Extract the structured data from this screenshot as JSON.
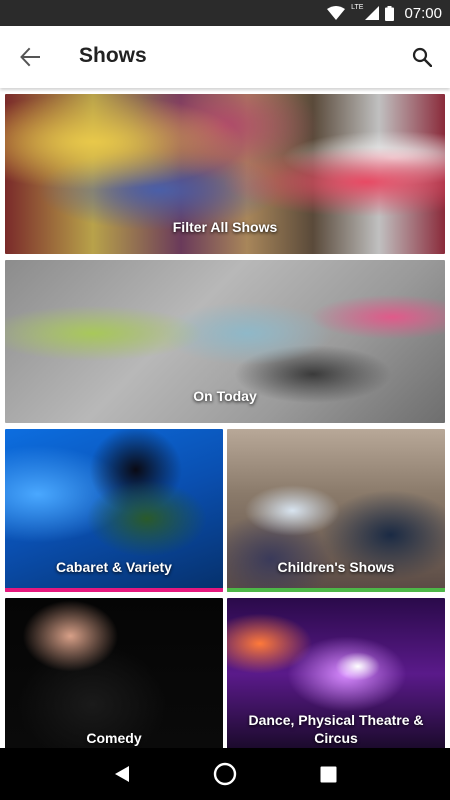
{
  "status_bar": {
    "network_type": "LTE",
    "time": "07:00"
  },
  "app_bar": {
    "title": "Shows",
    "back_icon": "arrow-back-icon",
    "search_icon": "search-icon"
  },
  "tiles": [
    {
      "label": "Filter All Shows",
      "accent_color": ""
    },
    {
      "label": "On Today",
      "accent_color": ""
    },
    {
      "label": "Cabaret & Variety",
      "accent_color": "#e6187e"
    },
    {
      "label": "Children's Shows",
      "accent_color": "#4db848"
    },
    {
      "label": "Comedy",
      "accent_color": ""
    },
    {
      "label": "Dance, Physical Theatre & Circus",
      "accent_color": ""
    }
  ],
  "nav_bar": {
    "back": "triangle-back-icon",
    "home": "circle-home-icon",
    "recents": "square-recents-icon"
  }
}
